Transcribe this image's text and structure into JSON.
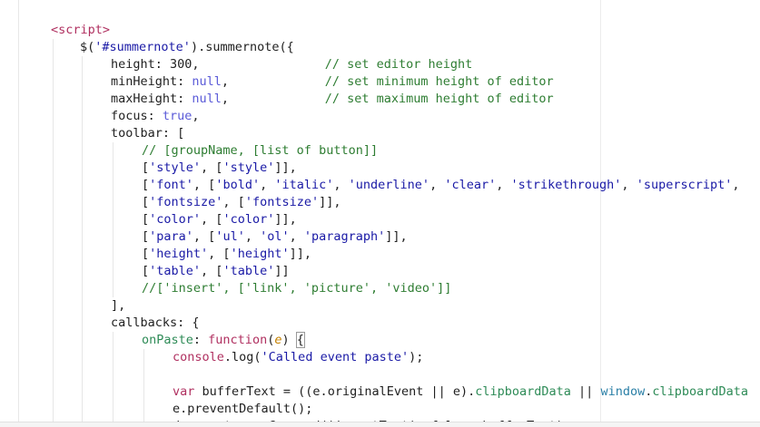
{
  "code_lines": [
    {
      "indent": 56,
      "tokens": [
        [
          "tag",
          "<script>"
        ]
      ]
    },
    {
      "indent": 88,
      "tokens": [
        [
          "plain",
          "$("
        ],
        [
          "str",
          "'#summernote'"
        ],
        [
          "plain",
          ").summernote({"
        ]
      ]
    },
    {
      "indent": 122,
      "tokens": [
        [
          "plain",
          "height: "
        ],
        [
          "num",
          "300"
        ],
        [
          "plain",
          ",                 "
        ],
        [
          "cm",
          "// set editor height"
        ]
      ]
    },
    {
      "indent": 122,
      "tokens": [
        [
          "plain",
          "minHeight: "
        ],
        [
          "kw",
          "null"
        ],
        [
          "plain",
          ",             "
        ],
        [
          "cm",
          "// set minimum height of editor"
        ]
      ]
    },
    {
      "indent": 122,
      "tokens": [
        [
          "plain",
          "maxHeight: "
        ],
        [
          "kw",
          "null"
        ],
        [
          "plain",
          ",             "
        ],
        [
          "cm",
          "// set maximum height of editor"
        ]
      ]
    },
    {
      "indent": 122,
      "tokens": [
        [
          "plain",
          "focus: "
        ],
        [
          "kw",
          "true"
        ],
        [
          "plain",
          ","
        ]
      ]
    },
    {
      "indent": 122,
      "tokens": [
        [
          "plain",
          "toolbar: ["
        ]
      ]
    },
    {
      "indent": 156,
      "tokens": [
        [
          "cm",
          "// [groupName, [list of button]]"
        ]
      ]
    },
    {
      "indent": 156,
      "tokens": [
        [
          "plain",
          "["
        ],
        [
          "str",
          "'style'"
        ],
        [
          "plain",
          ", ["
        ],
        [
          "str",
          "'style'"
        ],
        [
          "plain",
          "]],"
        ]
      ]
    },
    {
      "indent": 156,
      "tokens": [
        [
          "plain",
          "["
        ],
        [
          "str",
          "'font'"
        ],
        [
          "plain",
          ", ["
        ],
        [
          "str",
          "'bold'"
        ],
        [
          "plain",
          ", "
        ],
        [
          "str",
          "'italic'"
        ],
        [
          "plain",
          ", "
        ],
        [
          "str",
          "'underline'"
        ],
        [
          "plain",
          ", "
        ],
        [
          "str",
          "'clear'"
        ],
        [
          "plain",
          ", "
        ],
        [
          "str",
          "'strikethrough'"
        ],
        [
          "plain",
          ", "
        ],
        [
          "str",
          "'superscript'"
        ],
        [
          "plain",
          ","
        ]
      ]
    },
    {
      "indent": 156,
      "tokens": [
        [
          "plain",
          "["
        ],
        [
          "str",
          "'fontsize'"
        ],
        [
          "plain",
          ", ["
        ],
        [
          "str",
          "'fontsize'"
        ],
        [
          "plain",
          "]],"
        ]
      ]
    },
    {
      "indent": 156,
      "tokens": [
        [
          "plain",
          "["
        ],
        [
          "str",
          "'color'"
        ],
        [
          "plain",
          ", ["
        ],
        [
          "str",
          "'color'"
        ],
        [
          "plain",
          "]],"
        ]
      ]
    },
    {
      "indent": 156,
      "tokens": [
        [
          "plain",
          "["
        ],
        [
          "str",
          "'para'"
        ],
        [
          "plain",
          ", ["
        ],
        [
          "str",
          "'ul'"
        ],
        [
          "plain",
          ", "
        ],
        [
          "str",
          "'ol'"
        ],
        [
          "plain",
          ", "
        ],
        [
          "str",
          "'paragraph'"
        ],
        [
          "plain",
          "]],"
        ]
      ]
    },
    {
      "indent": 156,
      "tokens": [
        [
          "plain",
          "["
        ],
        [
          "str",
          "'height'"
        ],
        [
          "plain",
          ", ["
        ],
        [
          "str",
          "'height'"
        ],
        [
          "plain",
          "]],"
        ]
      ]
    },
    {
      "indent": 156,
      "tokens": [
        [
          "plain",
          "["
        ],
        [
          "str",
          "'table'"
        ],
        [
          "plain",
          ", ["
        ],
        [
          "str",
          "'table'"
        ],
        [
          "plain",
          "]]"
        ]
      ]
    },
    {
      "indent": 156,
      "tokens": [
        [
          "cm",
          "//['insert', ['link', 'picture', 'video']]"
        ]
      ]
    },
    {
      "indent": 122,
      "tokens": [
        [
          "plain",
          "],"
        ]
      ]
    },
    {
      "indent": 122,
      "tokens": [
        [
          "plain",
          "callbacks: {"
        ]
      ]
    },
    {
      "indent": 156,
      "tokens": [
        [
          "fn",
          "onPaste"
        ],
        [
          "plain",
          ": "
        ],
        [
          "decl",
          "function"
        ],
        [
          "plain",
          "("
        ],
        [
          "param",
          "e"
        ],
        [
          "plain",
          ") "
        ],
        [
          "match",
          "{"
        ]
      ]
    },
    {
      "indent": 190,
      "tokens": [
        [
          "console",
          "console"
        ],
        [
          "plain",
          ".log("
        ],
        [
          "str",
          "'Called event paste'"
        ],
        [
          "plain",
          ");"
        ]
      ]
    },
    {
      "indent": 190,
      "tokens": []
    },
    {
      "indent": 190,
      "tokens": [
        [
          "decl",
          "var"
        ],
        [
          "plain",
          " bufferText = ((e.originalEvent || e)."
        ],
        [
          "prop2",
          "clipboardData"
        ],
        [
          "plain",
          " || "
        ],
        [
          "win",
          "window"
        ],
        [
          "plain",
          "."
        ],
        [
          "prop2",
          "clipboardData"
        ]
      ]
    },
    {
      "indent": 190,
      "tokens": [
        [
          "plain",
          "e.preventDefault();"
        ]
      ]
    },
    {
      "indent": 190,
      "tokens": [
        [
          "plain",
          "document.execCommand('insertText', false, bufferText);"
        ]
      ]
    }
  ],
  "colors": {
    "background": "#ffffff",
    "tag": "#b03060",
    "string": "#1a1aa6",
    "keyword": "#5a5ad8",
    "comment": "#2e7d32"
  }
}
